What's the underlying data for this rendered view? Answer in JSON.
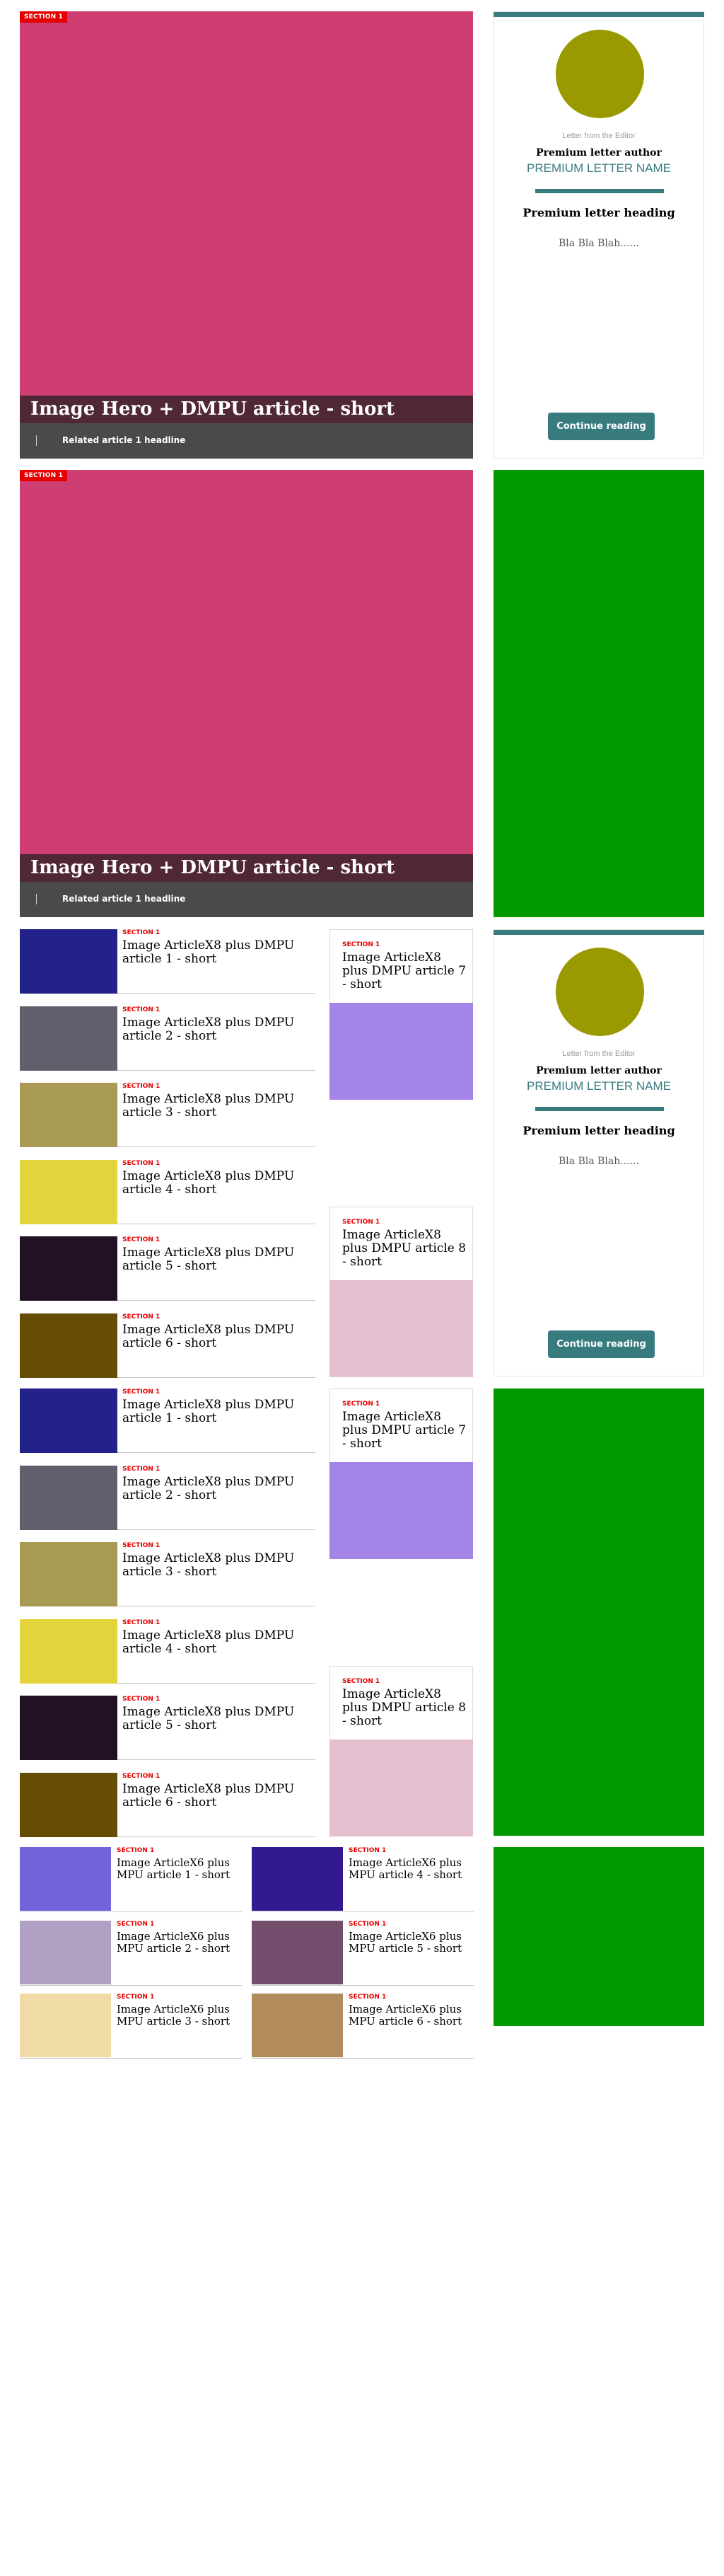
{
  "colors": {
    "accent": "#387b7f",
    "section_badge": "#e60000",
    "hero_image": "#cf3e72",
    "avatar": "#999900",
    "ad_green": "#009900"
  },
  "heroes": [
    {
      "section": "SECTION 1",
      "title": "Image Hero + DMPU article - short",
      "related": "Related article 1 headline"
    },
    {
      "section": "SECTION 1",
      "title": "Image Hero + DMPU article - short",
      "related": "Related article 1 headline"
    }
  ],
  "letters": [
    {
      "kicker": "Letter from the Editor",
      "author": "Premium letter author",
      "name": "PREMIUM LETTER NAME",
      "heading": "Premium letter heading",
      "body": "Bla Bla Blah......",
      "cta": "Continue reading"
    },
    {
      "kicker": "Letter from the Editor",
      "author": "Premium letter author",
      "name": "PREMIUM LETTER NAME",
      "heading": "Premium letter heading",
      "body": "Bla Bla Blah......",
      "cta": "Continue reading"
    }
  ],
  "x8_block_1": {
    "list": [
      {
        "section": "SECTION 1",
        "title": "Image ArticleX8 plus DMPU article 1 - short",
        "color": "#22228a"
      },
      {
        "section": "SECTION 1",
        "title": "Image ArticleX8 plus DMPU article 2 - short",
        "color": "#625e6c"
      },
      {
        "section": "SECTION 1",
        "title": "Image ArticleX8 plus DMPU article 3 - short",
        "color": "#a89a55"
      },
      {
        "section": "SECTION 1",
        "title": "Image ArticleX8 plus DMPU article 4 - short",
        "color": "#e2d43a"
      },
      {
        "section": "SECTION 1",
        "title": "Image ArticleX8 plus DMPU article 5 - short",
        "color": "#221024"
      },
      {
        "section": "SECTION 1",
        "title": "Image ArticleX8 plus DMPU article 6 - short",
        "color": "#664d06"
      }
    ],
    "side": [
      {
        "section": "SECTION 1",
        "title": "Image ArticleX8 plus DMPU article 7 - short",
        "color": "#a484e6"
      },
      {
        "section": "SECTION 1",
        "title": "Image ArticleX8 plus DMPU article 8 - short",
        "color": "#e4bfcf"
      }
    ]
  },
  "x8_block_2": {
    "list": [
      {
        "section": "SECTION 1",
        "title": "Image ArticleX8 plus DMPU article 1 - short",
        "color": "#22228a"
      },
      {
        "section": "SECTION 1",
        "title": "Image ArticleX8 plus DMPU article 2 - short",
        "color": "#625e6c"
      },
      {
        "section": "SECTION 1",
        "title": "Image ArticleX8 plus DMPU article 3 - short",
        "color": "#a89a55"
      },
      {
        "section": "SECTION 1",
        "title": "Image ArticleX8 plus DMPU article 4 - short",
        "color": "#e2d43a"
      },
      {
        "section": "SECTION 1",
        "title": "Image ArticleX8 plus DMPU article 5 - short",
        "color": "#221024"
      },
      {
        "section": "SECTION 1",
        "title": "Image ArticleX8 plus DMPU article 6 - short",
        "color": "#664d06"
      }
    ],
    "side": [
      {
        "section": "SECTION 1",
        "title": "Image ArticleX8 plus DMPU article 7 - short",
        "color": "#a484e6"
      },
      {
        "section": "SECTION 1",
        "title": "Image ArticleX8 plus DMPU article 8 - short",
        "color": "#e4bfcf"
      }
    ]
  },
  "x6_block": [
    {
      "section": "SECTION 1",
      "title": "Image ArticleX6 plus MPU article 1 - short",
      "color": "#7163d9"
    },
    {
      "section": "SECTION 1",
      "title": "Image ArticleX6 plus MPU article 2 - short",
      "color": "#b0a0c4"
    },
    {
      "section": "SECTION 1",
      "title": "Image ArticleX6 plus MPU article 3 - short",
      "color": "#f0dba6"
    },
    {
      "section": "SECTION 1",
      "title": "Image ArticleX6 plus MPU article 4 - short",
      "color": "#33198f"
    },
    {
      "section": "SECTION 1",
      "title": "Image ArticleX6 plus MPU article 5 - short",
      "color": "#734e6d"
    },
    {
      "section": "SECTION 1",
      "title": "Image ArticleX6 plus MPU article 6 - short",
      "color": "#b28b5c"
    }
  ]
}
